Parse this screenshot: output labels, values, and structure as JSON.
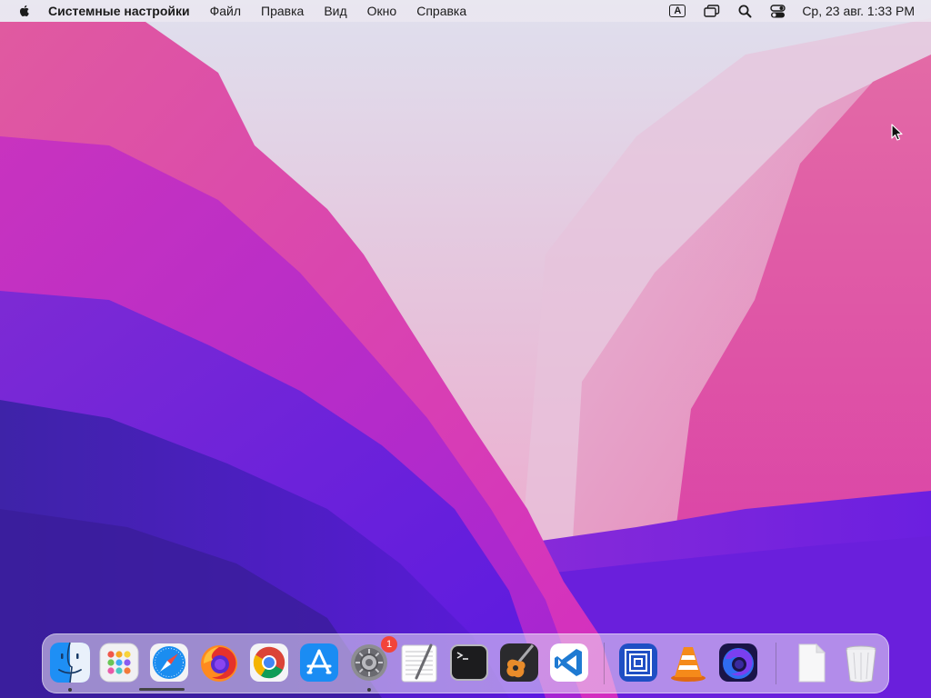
{
  "menubar": {
    "app_name": "Системные настройки",
    "items": [
      "Файл",
      "Правка",
      "Вид",
      "Окно",
      "Справка"
    ],
    "input_source": "A",
    "clock": "Ср, 23 авг.  1:33 PM"
  },
  "dock": {
    "apps": [
      {
        "name": "Finder",
        "icon": "finder-icon",
        "running": true
      },
      {
        "name": "Launchpad",
        "icon": "launchpad-icon",
        "running": false
      },
      {
        "name": "Safari",
        "icon": "safari-icon",
        "running": false
      },
      {
        "name": "Firefox",
        "icon": "firefox-icon",
        "running": false
      },
      {
        "name": "Google Chrome",
        "icon": "chrome-icon",
        "running": false
      },
      {
        "name": "App Store",
        "icon": "app-store-icon",
        "running": false
      },
      {
        "name": "System Preferences",
        "icon": "gear-icon",
        "running": true,
        "badge": "1"
      },
      {
        "name": "TextEdit",
        "icon": "textedit-icon",
        "running": false
      },
      {
        "name": "Terminal",
        "icon": "terminal-icon",
        "running": false
      },
      {
        "name": "GarageBand",
        "icon": "guitar-icon",
        "running": false
      },
      {
        "name": "Visual Studio Code",
        "icon": "vscode-icon",
        "running": false
      },
      {
        "name": "Parallels",
        "icon": "parallels-icon",
        "running": false
      },
      {
        "name": "VLC",
        "icon": "vlc-cone-icon",
        "running": false
      },
      {
        "name": "Firefox Nightly",
        "icon": "firefox-nightly-icon",
        "running": false
      },
      {
        "name": "Document",
        "icon": "document-icon",
        "running": false
      },
      {
        "name": "Trash",
        "icon": "trash-icon",
        "running": false
      }
    ]
  },
  "colors": {
    "menubar_bg": "#ece8f0",
    "badge": "#f2443a",
    "wallpaper_pink": "#e23aa6",
    "wallpaper_purple": "#6a1fd8"
  }
}
